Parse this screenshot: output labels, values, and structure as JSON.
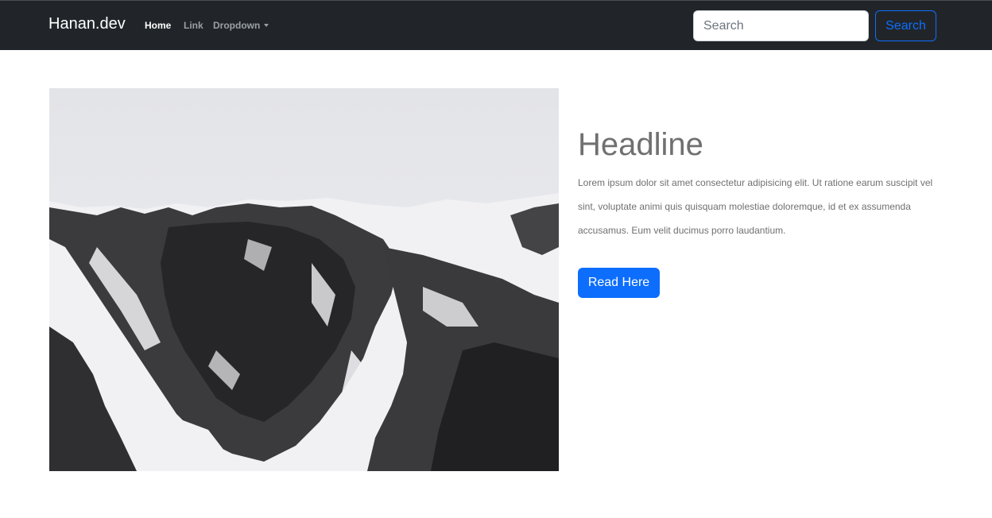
{
  "navbar": {
    "brand": "Hanan.dev",
    "links": [
      {
        "label": "Home"
      },
      {
        "label": "Link"
      },
      {
        "label": "Dropdown"
      }
    ],
    "search": {
      "placeholder": "Search",
      "value": "",
      "button_label": "Search"
    }
  },
  "main": {
    "image_alt": "snowy rocky mountain slope",
    "headline": "Headline",
    "lead": "Lorem ipsum dolor sit amet consectetur adipisicing elit. Ut ratione earum suscipit vel sint, voluptate animi quis quisquam molestiae doloremque, id et ex assumenda accusamus. Eum velit ducimus porro laudantium.",
    "button_label": "Read Here"
  },
  "colors": {
    "navbar_bg": "#212529",
    "primary": "#0d6efd",
    "text_muted": "#707070"
  }
}
